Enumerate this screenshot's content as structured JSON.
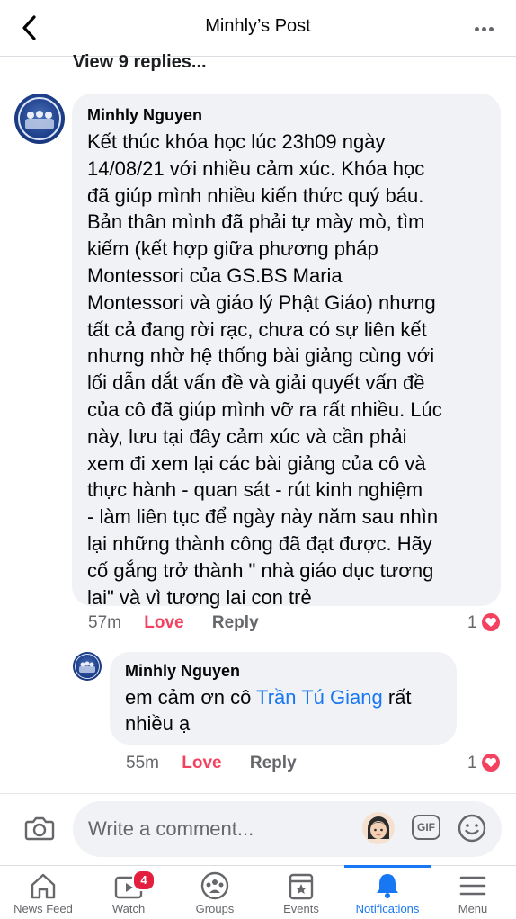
{
  "header": {
    "title": "Minhly’s Post"
  },
  "thread": {
    "view_replies": "View 9 replies..."
  },
  "comment": {
    "author": "Minhly Nguyen",
    "text": "Kết thúc khóa học lúc 23h09 ngày\n14/08/21 với nhiều cảm xúc. Khóa học\nđã giúp mình nhiều kiến thức quý báu.\nBản thân mình đã phải tự mày mò, tìm\nkiếm (kết hợp giữa phương pháp\nMontessori của GS.BS Maria\nMontessori và giáo lý  Phật Giáo) nhưng\ntất cả đang rời rạc, chưa có sự liên kết\nnhưng nhờ hệ thống bài giảng cùng với\nlối dẫn dắt vấn đề và giải quyết vấn đề\ncủa cô đã giúp mình vỡ ra rất nhiều. Lúc\nnày, lưu tại đây cảm xúc và cần phải\nxem đi xem lại các bài giảng của cô và\nthực hành - quan sát - rút kinh nghiệm\n- làm liên tục để ngày này năm sau nhìn\nlại những thành công đã đạt được. Hãy\ncố gắng trở thành \" nhà giáo dục tương\nlai\" và vì tương lai con trẻ",
    "time": "57m",
    "love_label": "Love",
    "reply_label": "Reply",
    "reactions": "1"
  },
  "reply": {
    "author": "Minhly Nguyen",
    "text_before": "em cảm ơn cô ",
    "mention": "Trần Tú Giang",
    "text_after": " rất\nnhiều ạ",
    "time": "55m",
    "love_label": "Love",
    "reply_label": "Reply",
    "reactions": "1"
  },
  "composer": {
    "placeholder": "Write a comment...",
    "gif_label": "GIF"
  },
  "tabs": [
    {
      "label": "News Feed",
      "icon": "home-icon"
    },
    {
      "label": "Watch",
      "icon": "watch-icon",
      "badge": "4"
    },
    {
      "label": "Groups",
      "icon": "groups-icon"
    },
    {
      "label": "Events",
      "icon": "events-icon"
    },
    {
      "label": "Notifications",
      "icon": "bell-icon",
      "active": true
    },
    {
      "label": "Menu",
      "icon": "menu-icon"
    }
  ],
  "colors": {
    "accent": "#1877f2",
    "love": "#f3425f",
    "bubble": "#f0f2f5",
    "muted": "#65676b"
  }
}
